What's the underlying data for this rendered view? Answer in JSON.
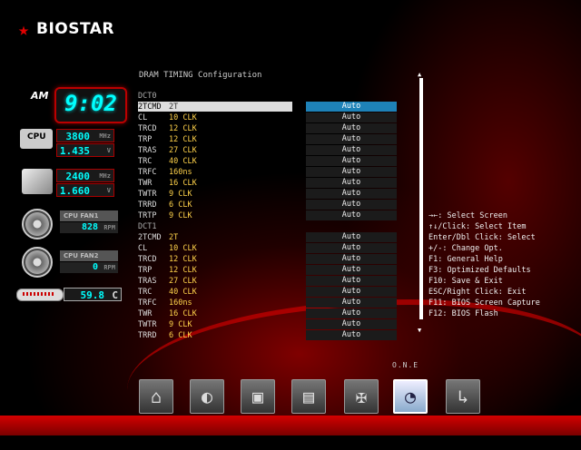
{
  "brand": {
    "name": "BIOSTAR"
  },
  "hardware": {
    "clock": {
      "ampm": "AM",
      "time": "9:02"
    },
    "cpu": {
      "label": "CPU",
      "freq": "3800",
      "freq_unit": "MHz",
      "voltage": "1.435",
      "voltage_unit": "V"
    },
    "memory": {
      "freq": "2400",
      "freq_unit": "MHz",
      "voltage": "1.660",
      "voltage_unit": "V"
    },
    "fan1": {
      "label": "CPU FAN1",
      "rpm": "828",
      "unit": "RPM"
    },
    "fan2": {
      "label": "CPU FAN2",
      "rpm": "0",
      "unit": "RPM"
    },
    "temp": {
      "value": "59.8",
      "unit": "C"
    }
  },
  "main": {
    "title": "DRAM TIMING Configuration",
    "dct0": {
      "label": "DCT0",
      "rows": [
        {
          "name": "2TCMD",
          "value": "2T",
          "setting": "Auto"
        },
        {
          "name": "CL",
          "value": "10 CLK",
          "setting": "Auto"
        },
        {
          "name": "TRCD",
          "value": "12 CLK",
          "setting": "Auto"
        },
        {
          "name": "TRP",
          "value": "12 CLK",
          "setting": "Auto"
        },
        {
          "name": "TRAS",
          "value": "27 CLK",
          "setting": "Auto"
        },
        {
          "name": "TRC",
          "value": "40 CLK",
          "setting": "Auto"
        },
        {
          "name": "TRFC",
          "value": "160ns",
          "setting": "Auto"
        },
        {
          "name": "TWR",
          "value": "16 CLK",
          "setting": "Auto"
        },
        {
          "name": "TWTR",
          "value": "9 CLK",
          "setting": "Auto"
        },
        {
          "name": "TRRD",
          "value": "6 CLK",
          "setting": "Auto"
        },
        {
          "name": "TRTP",
          "value": "9 CLK",
          "setting": "Auto"
        }
      ]
    },
    "dct1": {
      "label": "DCT1",
      "rows": [
        {
          "name": "2TCMD",
          "value": "2T",
          "setting": "Auto"
        },
        {
          "name": "CL",
          "value": "10 CLK",
          "setting": "Auto"
        },
        {
          "name": "TRCD",
          "value": "12 CLK",
          "setting": "Auto"
        },
        {
          "name": "TRP",
          "value": "12 CLK",
          "setting": "Auto"
        },
        {
          "name": "TRAS",
          "value": "27 CLK",
          "setting": "Auto"
        },
        {
          "name": "TRC",
          "value": "40 CLK",
          "setting": "Auto"
        },
        {
          "name": "TRFC",
          "value": "160ns",
          "setting": "Auto"
        },
        {
          "name": "TWR",
          "value": "16 CLK",
          "setting": "Auto"
        },
        {
          "name": "TWTR",
          "value": "9 CLK",
          "setting": "Auto"
        },
        {
          "name": "TRRD",
          "value": "6 CLK",
          "setting": "Auto"
        }
      ]
    }
  },
  "help": [
    "→←: Select Screen",
    "↑↓/Click: Select Item",
    "Enter/Dbl Click: Select",
    "+/-: Change Opt.",
    "F1: General Help",
    "F3: Optimized Defaults",
    "F10: Save & Exit",
    "ESC/Right Click: Exit",
    "F11: BIOS Screen Capture",
    "F12: BIOS Flash"
  ],
  "nav": {
    "active_label": "O.N.E",
    "items": [
      {
        "id": "home",
        "icon": "home-icon",
        "glyph": "⌂"
      },
      {
        "id": "advanced",
        "icon": "advanced-icon",
        "glyph": "◐"
      },
      {
        "id": "chipset",
        "icon": "chipset-icon",
        "glyph": "▣"
      },
      {
        "id": "boot",
        "icon": "boot-icon",
        "glyph": "▤"
      },
      {
        "id": "security",
        "icon": "security-shield-icon",
        "glyph": "✠"
      },
      {
        "id": "one",
        "icon": "gauge-icon",
        "glyph": "◔"
      },
      {
        "id": "exit",
        "icon": "exit-icon",
        "glyph": "↳"
      }
    ],
    "active_index": 5
  },
  "colors": {
    "accent": "#1e82b8",
    "value_text": "#ffd24a",
    "led_text": "#00ffff"
  }
}
